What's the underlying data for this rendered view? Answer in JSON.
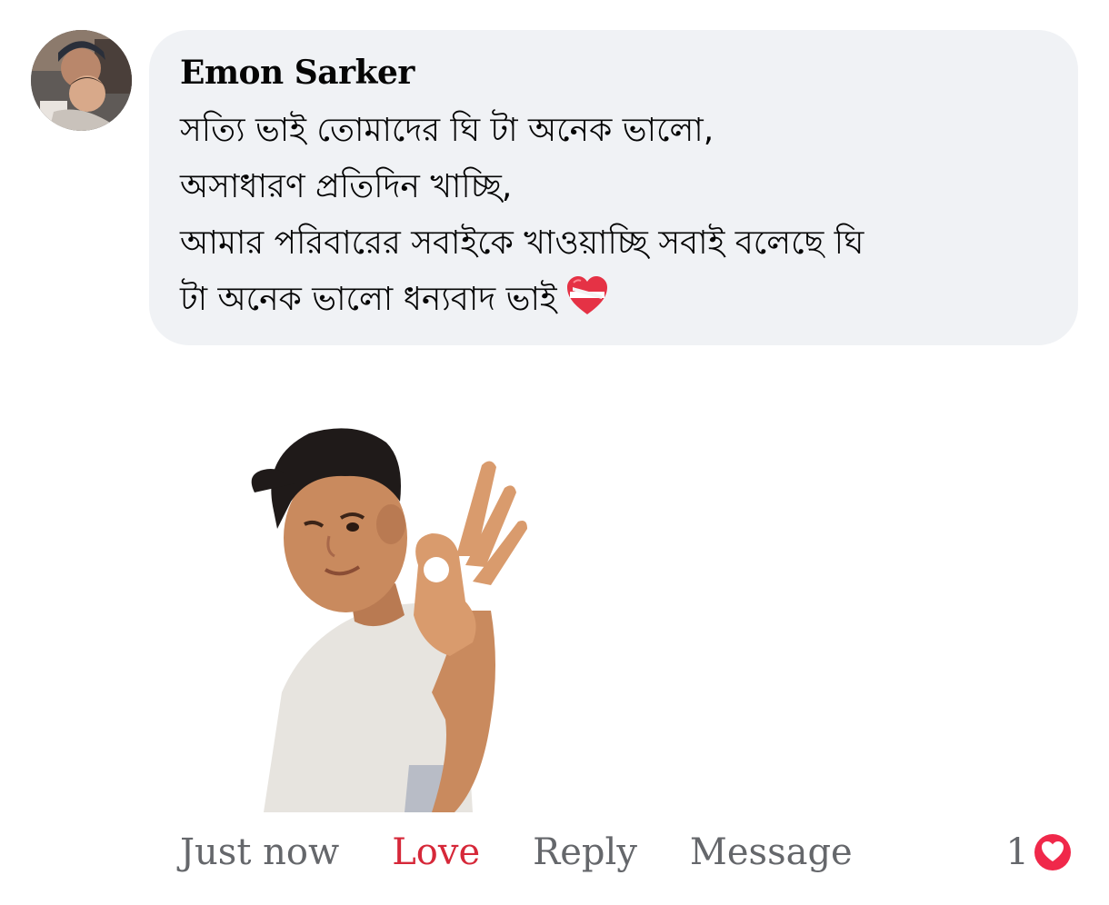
{
  "comment": {
    "author": "Emon Sarker",
    "text_lines": [
      "সত্যি ভাই তোমাদের ঘি টা অনেক ভালো,",
      "অসাধারণ প্রতিদিন খাচ্ছি,",
      "আমার পরিবারের সবাইকে খাওয়াচ্ছি সবাই বলেছে ঘি",
      "টা অনেক ভালো ধন্যবাদ ভাই"
    ],
    "emoji": "mending-heart-icon"
  },
  "sticker": {
    "icon": "avatar-ok-hand-sticker"
  },
  "actions": {
    "timestamp": "Just now",
    "love_label": "Love",
    "reply_label": "Reply",
    "message_label": "Message"
  },
  "reactions": {
    "count": "1",
    "icon": "love-reaction-icon"
  },
  "colors": {
    "bubble_bg": "#f0f2f5",
    "love_active": "#d62839",
    "secondary_text": "#65676b",
    "reaction_red": "#f0284a"
  }
}
